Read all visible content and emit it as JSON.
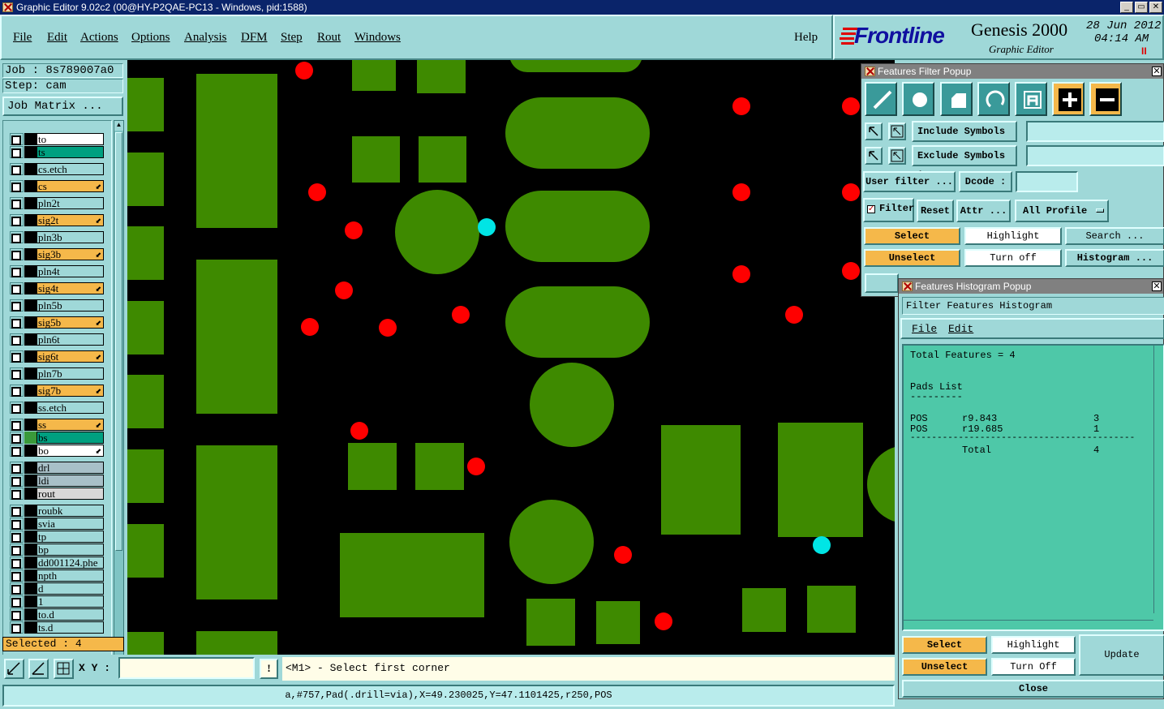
{
  "window": {
    "title": "Graphic Editor 9.02c2 (00@HY-P2QAE-PC13 - Windows, pid:1588)",
    "minimize": "_",
    "restore": "▭",
    "close": "✕"
  },
  "menu": {
    "items": [
      {
        "label": "File"
      },
      {
        "label": "Edit"
      },
      {
        "label": "Actions"
      },
      {
        "label": "Options"
      },
      {
        "label": "Analysis"
      },
      {
        "label": "DFM"
      },
      {
        "label": "Step"
      },
      {
        "label": "Rout"
      },
      {
        "label": "Windows"
      }
    ],
    "help": "Help"
  },
  "logo": {
    "brand": "Frontline",
    "product": "Genesis 2000",
    "subtitle": "Graphic Editor",
    "date": "28 Jun 2012",
    "time": "04:14 AM",
    "pause": "II"
  },
  "left": {
    "job": "Job : 8s789007a0",
    "step": "Step: cam",
    "job_matrix": "Job Matrix ...",
    "selected": "Selected : 4",
    "layers": [
      {
        "name": "to",
        "bg": "#ffffff",
        "sw": "#000000",
        "arrow": ""
      },
      {
        "name": "ts",
        "bg": "#00a080",
        "sw": "#000000",
        "arrow": ""
      },
      {
        "name": "cs.etch",
        "bg": "#9fd8d8",
        "sw": "#000000",
        "arrow": ""
      },
      {
        "name": "cs",
        "bg": "#f5b84a",
        "sw": "#000000",
        "arrow": "⬋"
      },
      {
        "name": "pln2t",
        "bg": "#9fd8d8",
        "sw": "#000000",
        "arrow": ""
      },
      {
        "name": "sig2t",
        "bg": "#f5b84a",
        "sw": "#000000",
        "arrow": "⬋"
      },
      {
        "name": "pln3b",
        "bg": "#9fd8d8",
        "sw": "#000000",
        "arrow": ""
      },
      {
        "name": "sig3b",
        "bg": "#f5b84a",
        "sw": "#000000",
        "arrow": "⬋"
      },
      {
        "name": "pln4t",
        "bg": "#9fd8d8",
        "sw": "#000000",
        "arrow": ""
      },
      {
        "name": "sig4t",
        "bg": "#f5b84a",
        "sw": "#000000",
        "arrow": "⬋"
      },
      {
        "name": "pln5b",
        "bg": "#9fd8d8",
        "sw": "#000000",
        "arrow": ""
      },
      {
        "name": "sig5b",
        "bg": "#f5b84a",
        "sw": "#000000",
        "arrow": "⬋"
      },
      {
        "name": "pln6t",
        "bg": "#9fd8d8",
        "sw": "#000000",
        "arrow": ""
      },
      {
        "name": "sig6t",
        "bg": "#f5b84a",
        "sw": "#000000",
        "arrow": "⬋"
      },
      {
        "name": "pln7b",
        "bg": "#9fd8d8",
        "sw": "#000000",
        "arrow": ""
      },
      {
        "name": "sig7b",
        "bg": "#f5b84a",
        "sw": "#000000",
        "arrow": "⬋"
      },
      {
        "name": "ss.etch",
        "bg": "#9fd8d8",
        "sw": "#000000",
        "arrow": ""
      },
      {
        "name": "ss",
        "bg": "#f5b84a",
        "sw": "#000000",
        "arrow": "⬋"
      },
      {
        "name": "bs",
        "bg": "#00a080",
        "sw": "#3a9a3a",
        "arrow": ""
      },
      {
        "name": "bo",
        "bg": "#ffffff",
        "sw": "#000000",
        "arrow": "⬋"
      },
      {
        "name": "drl",
        "bg": "#a8c0c8",
        "sw": "#000000",
        "arrow": ""
      },
      {
        "name": "ldi",
        "bg": "#a8c0c8",
        "sw": "#000000",
        "arrow": ""
      },
      {
        "name": "rout",
        "bg": "#d8d8d8",
        "sw": "#000000",
        "arrow": ""
      },
      {
        "name": "roubk",
        "bg": "#9fd8d8",
        "sw": "#000000",
        "arrow": ""
      },
      {
        "name": "svia",
        "bg": "#9fd8d8",
        "sw": "#000000",
        "arrow": ""
      },
      {
        "name": "tp",
        "bg": "#9fd8d8",
        "sw": "#000000",
        "arrow": ""
      },
      {
        "name": "bp",
        "bg": "#9fd8d8",
        "sw": "#000000",
        "arrow": ""
      },
      {
        "name": "dd001124.phe",
        "bg": "#9fd8d8",
        "sw": "#000000",
        "arrow": ""
      },
      {
        "name": "npth",
        "bg": "#9fd8d8",
        "sw": "#000000",
        "arrow": ""
      },
      {
        "name": "d",
        "bg": "#9fd8d8",
        "sw": "#000000",
        "arrow": ""
      },
      {
        "name": "1",
        "bg": "#9fd8d8",
        "sw": "#000000",
        "arrow": ""
      },
      {
        "name": "to.d",
        "bg": "#9fd8d8",
        "sw": "#000000",
        "arrow": ""
      },
      {
        "name": "ts.d",
        "bg": "#9fd8d8",
        "sw": "#000000",
        "arrow": ""
      }
    ]
  },
  "bottom": {
    "xy_label": "X Y :",
    "xy_value": "",
    "prompt": "<M1> - Select first corner",
    "status": "a,#757,Pad(.drill=via),X=49.230025,Y=47.1101425,r250,POS"
  },
  "filter": {
    "title": "Features Filter Popup",
    "include": "Include Symbols :",
    "exclude": "Exclude Symbols :",
    "user_filter": "User filter ...",
    "dcode": "Dcode :",
    "filter": "Filter",
    "reset": "Reset",
    "attr": "Attr ...",
    "profile": "All Profile",
    "select": "Select",
    "highlight": "Highlight",
    "search": "Search ...",
    "unselect": "Unselect",
    "turn_off": "Turn off",
    "histogram": "Histogram ..."
  },
  "histogram": {
    "title": "Features Histogram Popup",
    "header": "Filter Features Histogram",
    "menu_file": "File",
    "menu_edit": "Edit",
    "total_features": "Total Features = 4",
    "pads_list": "Pads List",
    "pads_underline": "---------",
    "rows": [
      {
        "pol": "POS",
        "sym": "r9.843",
        "count": "3"
      },
      {
        "pol": "POS",
        "sym": "r19.685",
        "count": "1"
      }
    ],
    "divider": "------------------------------------------",
    "total_label": "Total",
    "total_value": "4",
    "select": "Select",
    "highlight": "Highlight",
    "update": "Update",
    "unselect": "Unselect",
    "turn_off": "Turn Off",
    "close": "Close"
  },
  "colors": {
    "copper": "#3e8a00",
    "red_pad": "#ff0000",
    "selected_pad": "#00e5e5",
    "panel": "#9fd8d8",
    "orange": "#f5b84a"
  }
}
